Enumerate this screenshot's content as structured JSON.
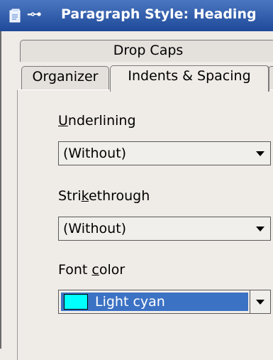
{
  "window": {
    "title": "Paragraph Style: Heading"
  },
  "tabs": {
    "back_row": [
      "Drop Caps"
    ],
    "front_row": [
      "Organizer",
      "Indents & Spacing"
    ],
    "active": "Indents & Spacing"
  },
  "underlining": {
    "label_prefix": "",
    "label_mnemonic": "U",
    "label_rest": "nderlining",
    "value": "(Without)"
  },
  "strikethrough": {
    "label_prefix": "Stri",
    "label_mnemonic": "k",
    "label_rest": "ethrough",
    "value": "(Without)"
  },
  "font_color": {
    "label_prefix": "Font ",
    "label_mnemonic": "c",
    "label_rest": "olor",
    "value": "Light cyan",
    "swatch_color": "#00ffff"
  },
  "icons": {
    "app": "writer-document-icon",
    "pin": "pin-icon",
    "dropdown": "chevron-down-icon"
  }
}
